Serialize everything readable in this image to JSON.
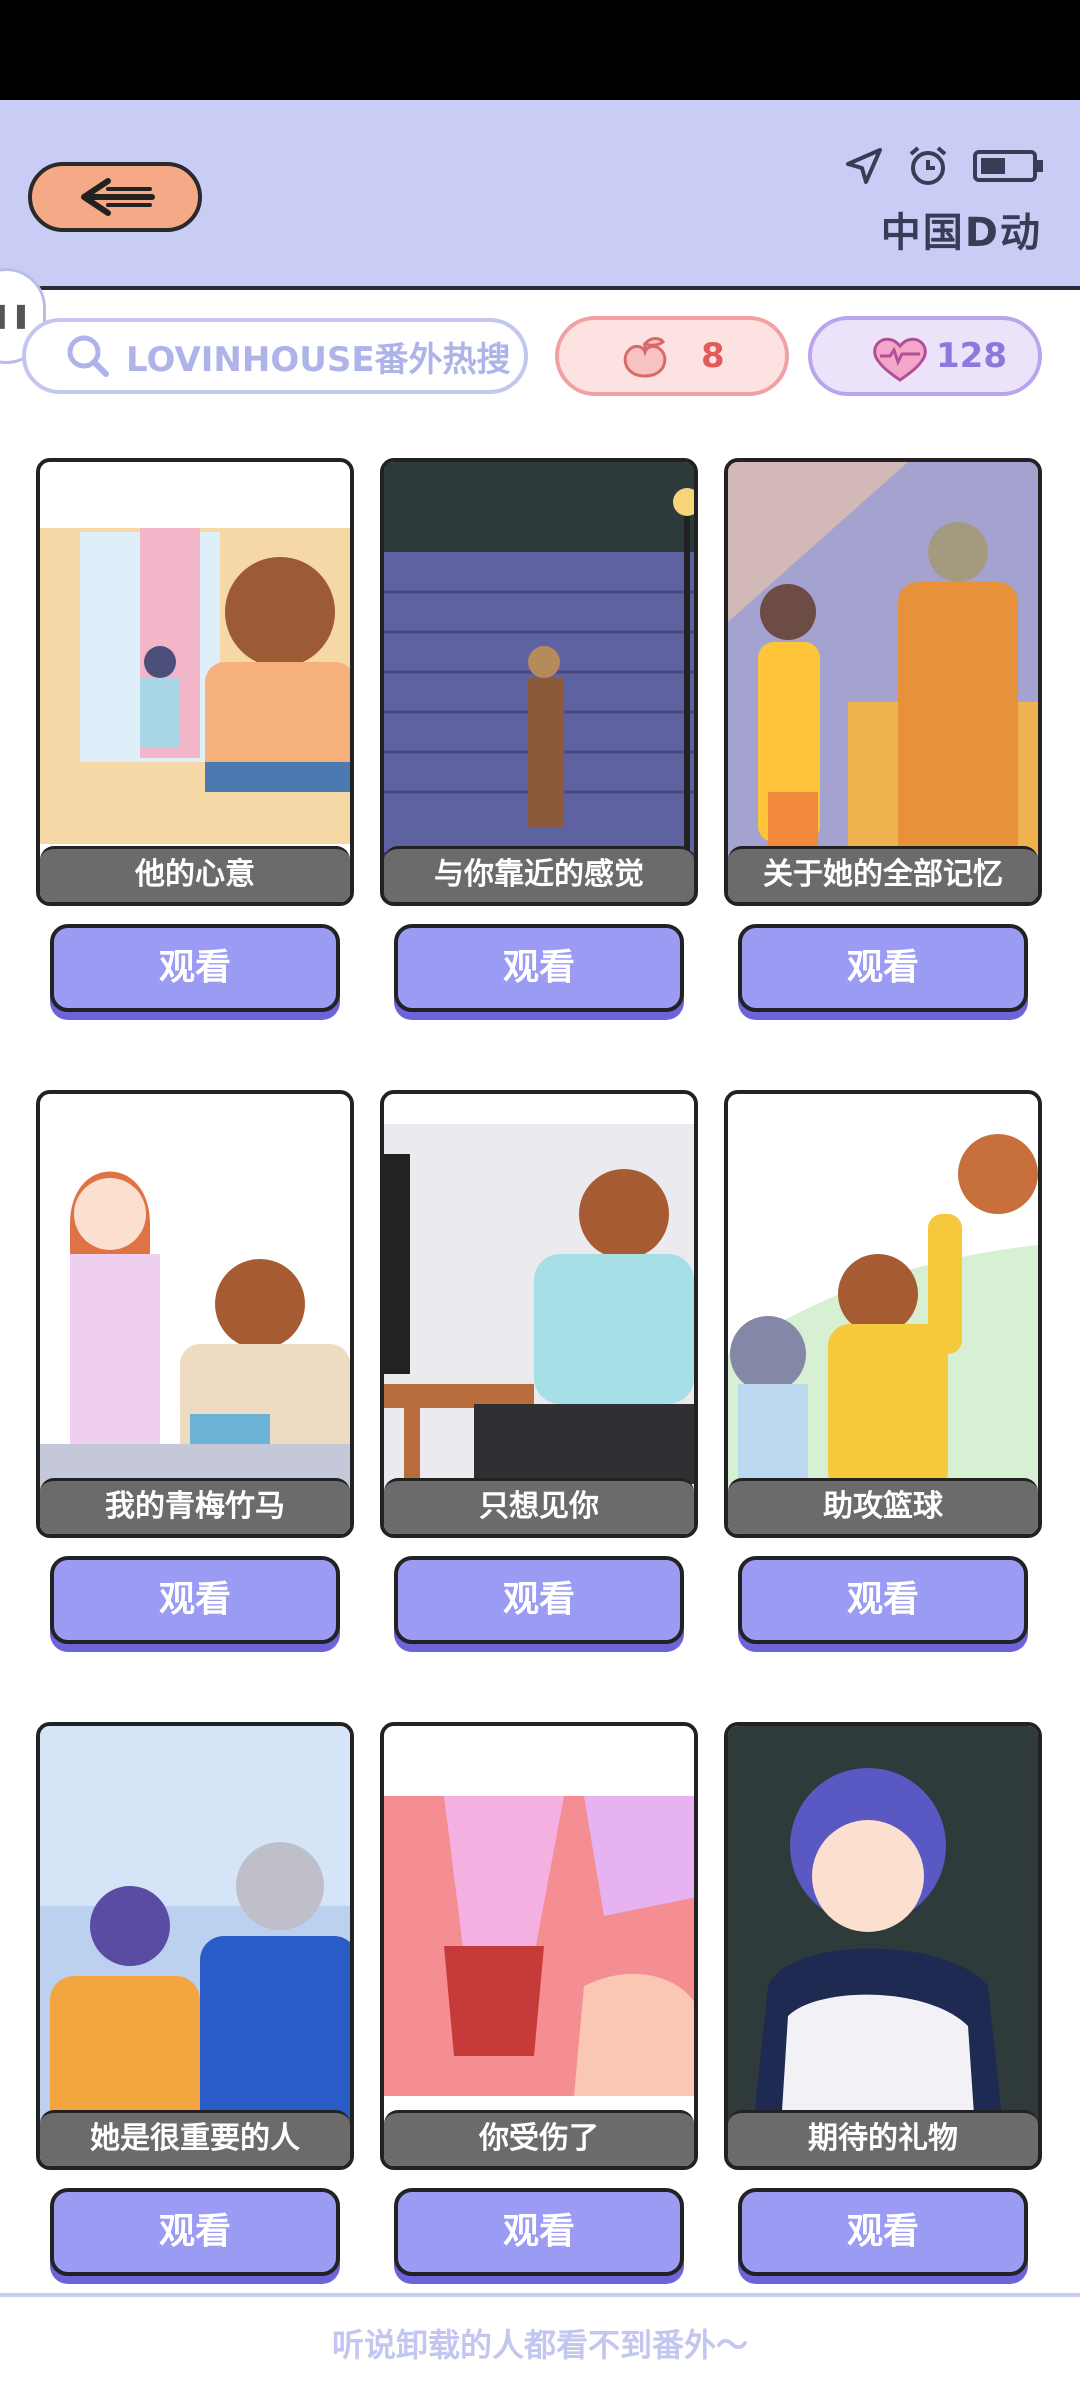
{
  "header": {
    "brand": "中国D动"
  },
  "search": {
    "placeholder": "LOVINHOUSE番外热搜"
  },
  "counters": {
    "peach": "8",
    "hearts": "128"
  },
  "cards": [
    {
      "title": "他的心意",
      "button": "观看"
    },
    {
      "title": "与你靠近的感觉",
      "button": "观看"
    },
    {
      "title": "关于她的全部记忆",
      "button": "观看"
    },
    {
      "title": "我的青梅竹马",
      "button": "观看"
    },
    {
      "title": "只想见你",
      "button": "观看"
    },
    {
      "title": "助攻篮球",
      "button": "观看"
    },
    {
      "title": "她是很重要的人",
      "button": "观看"
    },
    {
      "title": "你受伤了",
      "button": "观看"
    },
    {
      "title": "期待的礼物",
      "button": "观看"
    }
  ],
  "footer": {
    "text": "听说卸载的人都看不到番外～"
  },
  "colors": {
    "header_bg": "#c9cdf6",
    "button": "#9b9bf4",
    "back": "#f6a986"
  }
}
